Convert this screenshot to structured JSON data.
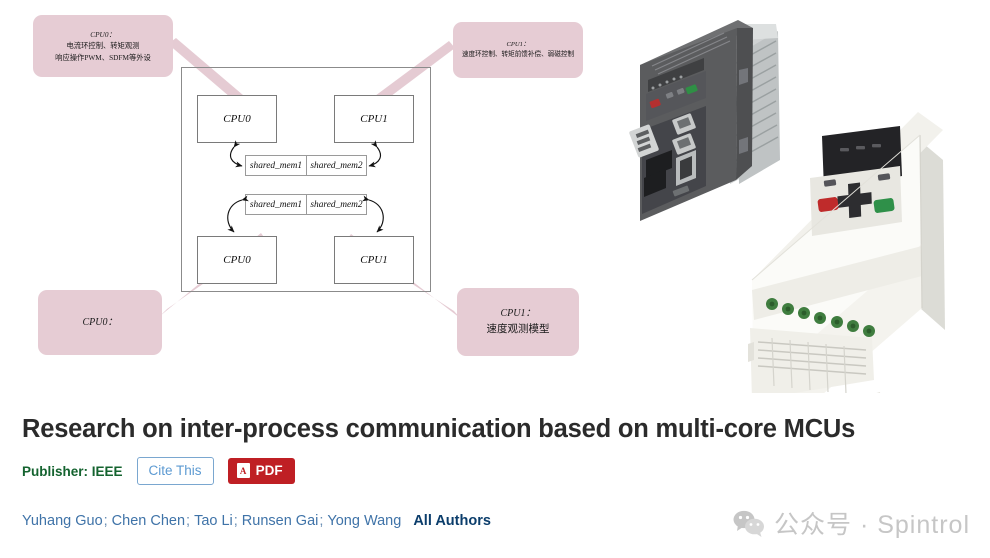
{
  "figure": {
    "callouts": [
      {
        "name": "callout-top-left",
        "cpu": "CPU0：",
        "line2": "电流环控制、转矩观测",
        "line3": "响应操作PWM、SDFM等外设"
      },
      {
        "name": "callout-top-right",
        "cpu": "CPU1：",
        "line2": "速度环控制、转矩前馈补偿、弱磁控制",
        "line3": ""
      },
      {
        "name": "callout-bottom-left",
        "cpu": "CPU0：",
        "line2": "",
        "line3": ""
      },
      {
        "name": "callout-bottom-right",
        "cpu": "CPU1：",
        "line2": "速度观测模型",
        "line3": ""
      }
    ],
    "diagram": {
      "cpu_top_left": "CPU0",
      "cpu_top_right": "CPU1",
      "cpu_bottom_left": "CPU0",
      "cpu_bottom_right": "CPU1",
      "shared_mem_top_left": "shared_mem1",
      "shared_mem_top_right": "shared_mem2",
      "shared_mem_bottom_left": "shared_mem1",
      "shared_mem_bottom_right": "shared_mem2"
    },
    "photos": {
      "servo_drive_label": "servo-drive-photo",
      "inverter_label": "inverter-drive-photo"
    },
    "colors": {
      "callout_pink": "#e6ccd4",
      "frame_gray": "#8b8b8b",
      "box_border": "#7a7a7a"
    }
  },
  "paper": {
    "title": "Research on inter-process communication based on multi-core MCUs",
    "publisher": "Publisher:  IEEE",
    "cite_this_label": "Cite This",
    "pdf_label": "PDF",
    "pdf_icon_glyph": "A",
    "authors": [
      "Yuhang Guo",
      "Chen Chen",
      "Tao Li",
      "Runsen Gai",
      "Yong Wang"
    ],
    "author_separator": ";",
    "all_authors_label": "All Authors",
    "colors": {
      "title": "#2b2b2b",
      "publisher_green": "#14632f",
      "cite_blue": "#5c9ad2",
      "pdf_red": "#bf1f24",
      "author_blue": "#3f73a8",
      "all_authors_blue": "#0b3d6b"
    }
  },
  "watermark": {
    "icon": "wechat-icon",
    "text": "公众号 · Spintrol",
    "color": "#c6c6c6"
  }
}
